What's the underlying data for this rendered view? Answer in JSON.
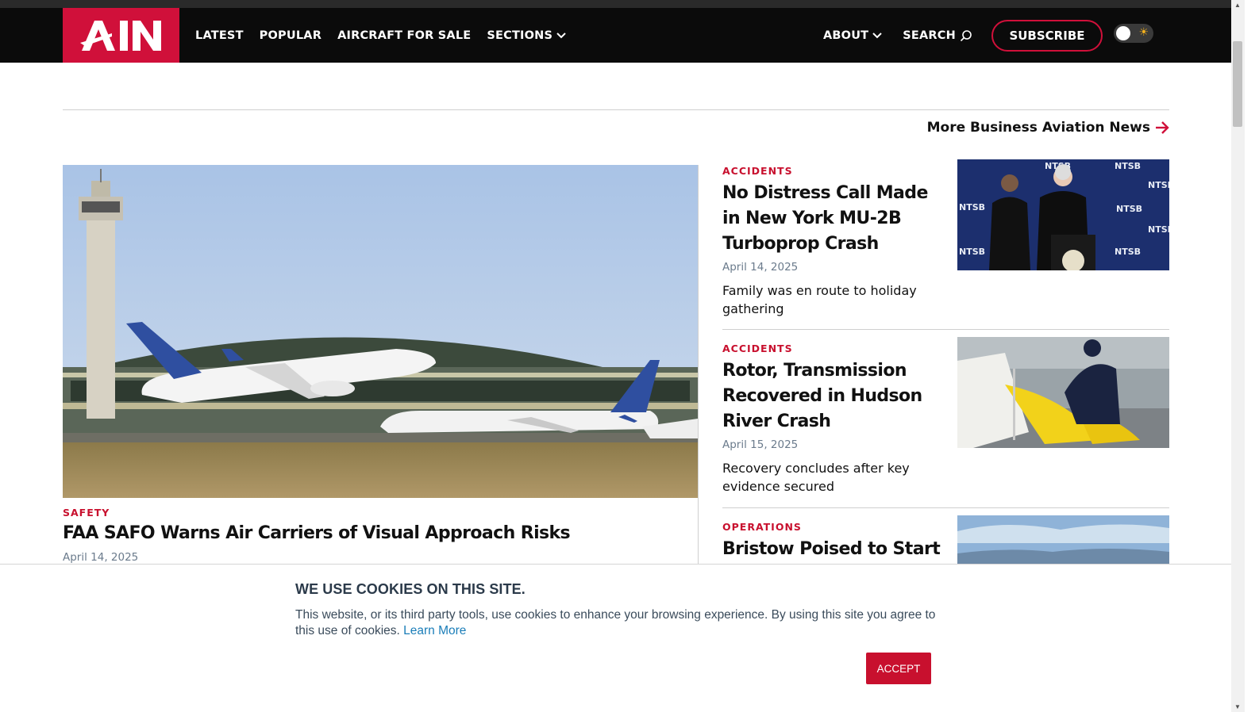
{
  "header": {
    "logo_text": "AIN",
    "nav": [
      {
        "label": "LATEST"
      },
      {
        "label": "POPULAR"
      },
      {
        "label": "AIRCRAFT FOR SALE"
      },
      {
        "label": "SECTIONS"
      }
    ],
    "about_label": "ABOUT",
    "search_label": "SEARCH",
    "subscribe_label": "SUBSCRIBE"
  },
  "main": {
    "more_news_label": "More Business Aviation News",
    "hero": {
      "category": "SAFETY",
      "title": "FAA SAFO Warns Air Carriers of Visual Approach Risks",
      "date": "April 14, 2025"
    },
    "stories": [
      {
        "category": "ACCIDENTS",
        "title": "No Distress Call Made in New York MU-2B Turboprop Crash",
        "date": "April 14, 2025",
        "description": "Family was en route to holiday gathering"
      },
      {
        "category": "ACCIDENTS",
        "title": "Rotor, Transmission Recovered in Hudson River Crash",
        "date": "April 15, 2025",
        "description": "Recovery concludes after key evidence secured"
      },
      {
        "category": "OPERATIONS",
        "title": "Bristow Poised to Start"
      }
    ],
    "ntsb_text": "NTSB"
  },
  "cookie": {
    "title": "WE USE COOKIES ON THIS SITE.",
    "text": "This website, or its third party tools, use cookies to enhance your browsing experience. By using this site you agree to this use of cookies.",
    "learn_more": "Learn More",
    "accept_label": "ACCEPT"
  },
  "colors": {
    "brand": "#d0103a",
    "category": "#c8102e",
    "nav_bg": "#0b0b0b",
    "link": "#1a7db8"
  }
}
